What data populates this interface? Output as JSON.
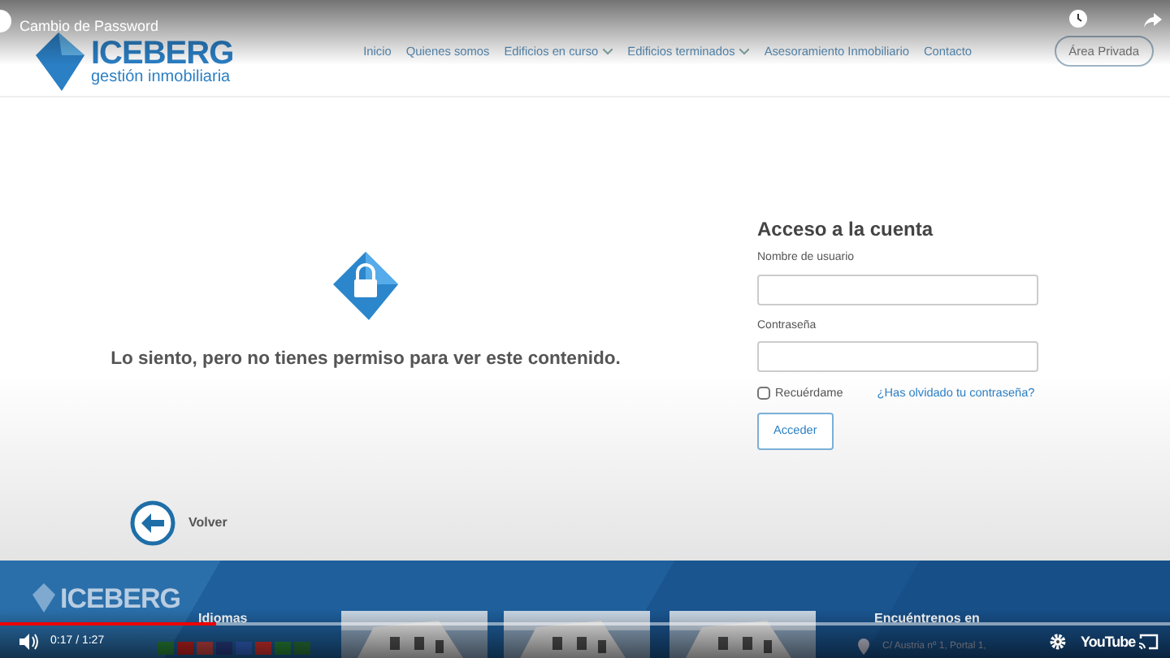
{
  "video": {
    "title": "Cambio de Password",
    "time": "0:17 / 1:27",
    "brand": "YouTube",
    "progress": {
      "level": 0.185
    }
  },
  "header": {
    "logo_name": "ICEBERG",
    "logo_tagline": "gestión inmobiliaria",
    "private_button": "Área Privada",
    "nav": [
      {
        "label": "Inicio",
        "dropdown": false
      },
      {
        "label": "Quienes somos",
        "dropdown": false
      },
      {
        "label": "Edificios en curso",
        "dropdown": true
      },
      {
        "label": "Edificios terminados",
        "dropdown": true
      },
      {
        "label": "Asesoramiento Inmobiliario",
        "dropdown": false
      },
      {
        "label": "Contacto",
        "dropdown": false
      }
    ]
  },
  "message": "Lo siento, pero no tienes permiso para ver este contenido.",
  "back_link": "Volver",
  "login": {
    "title": "Acceso a la cuenta",
    "username_label": "Nombre de usuario",
    "password_label": "Contraseña",
    "remember": {
      "label": "Recuérdame",
      "checked": false
    },
    "forgot_link": "¿Has olvidado tu contraseña?",
    "submit": "Acceder"
  },
  "footer": {
    "logo_name": "ICEBERG",
    "languages_title": "Idiomas",
    "location_title": "Encuéntrenos en",
    "address": "C/ Austria nº 1, Portal 1,"
  }
}
